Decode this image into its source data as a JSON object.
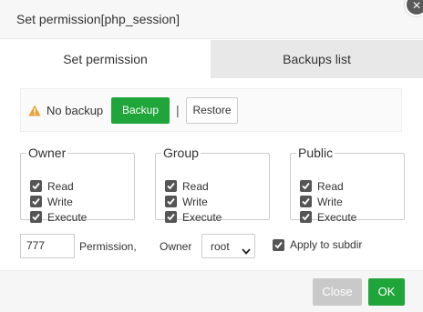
{
  "dialog": {
    "title": "Set permission[php_session]",
    "close_symbol": "×"
  },
  "tabs": [
    {
      "label": "Set permission",
      "active": true
    },
    {
      "label": "Backups list",
      "active": false
    }
  ],
  "backup": {
    "status": "No backup",
    "backup_label": "Backup",
    "divider": "|",
    "restore_label": "Restore",
    "warning_icon": "warning-triangle-icon",
    "warning_color": "#e8a23a"
  },
  "groups": [
    {
      "legend": "Owner",
      "items": [
        {
          "label": "Read",
          "checked": true
        },
        {
          "label": "Write",
          "checked": true
        },
        {
          "label": "Execute",
          "checked": true
        }
      ]
    },
    {
      "legend": "Group",
      "items": [
        {
          "label": "Read",
          "checked": true
        },
        {
          "label": "Write",
          "checked": true
        },
        {
          "label": "Execute",
          "checked": true
        }
      ]
    },
    {
      "legend": "Public",
      "items": [
        {
          "label": "Read",
          "checked": true
        },
        {
          "label": "Write",
          "checked": true
        },
        {
          "label": "Execute",
          "checked": true
        }
      ]
    }
  ],
  "permission": {
    "value": "777",
    "label": "Permission,"
  },
  "owner": {
    "label": "Owner",
    "selected": "root"
  },
  "apply_subdir": {
    "label": "Apply to subdir",
    "checked": true
  },
  "footer": {
    "close_label": "Close",
    "ok_label": "OK"
  },
  "colors": {
    "accent_green": "#20a53a",
    "close_disabled": "#c9c9c9"
  }
}
